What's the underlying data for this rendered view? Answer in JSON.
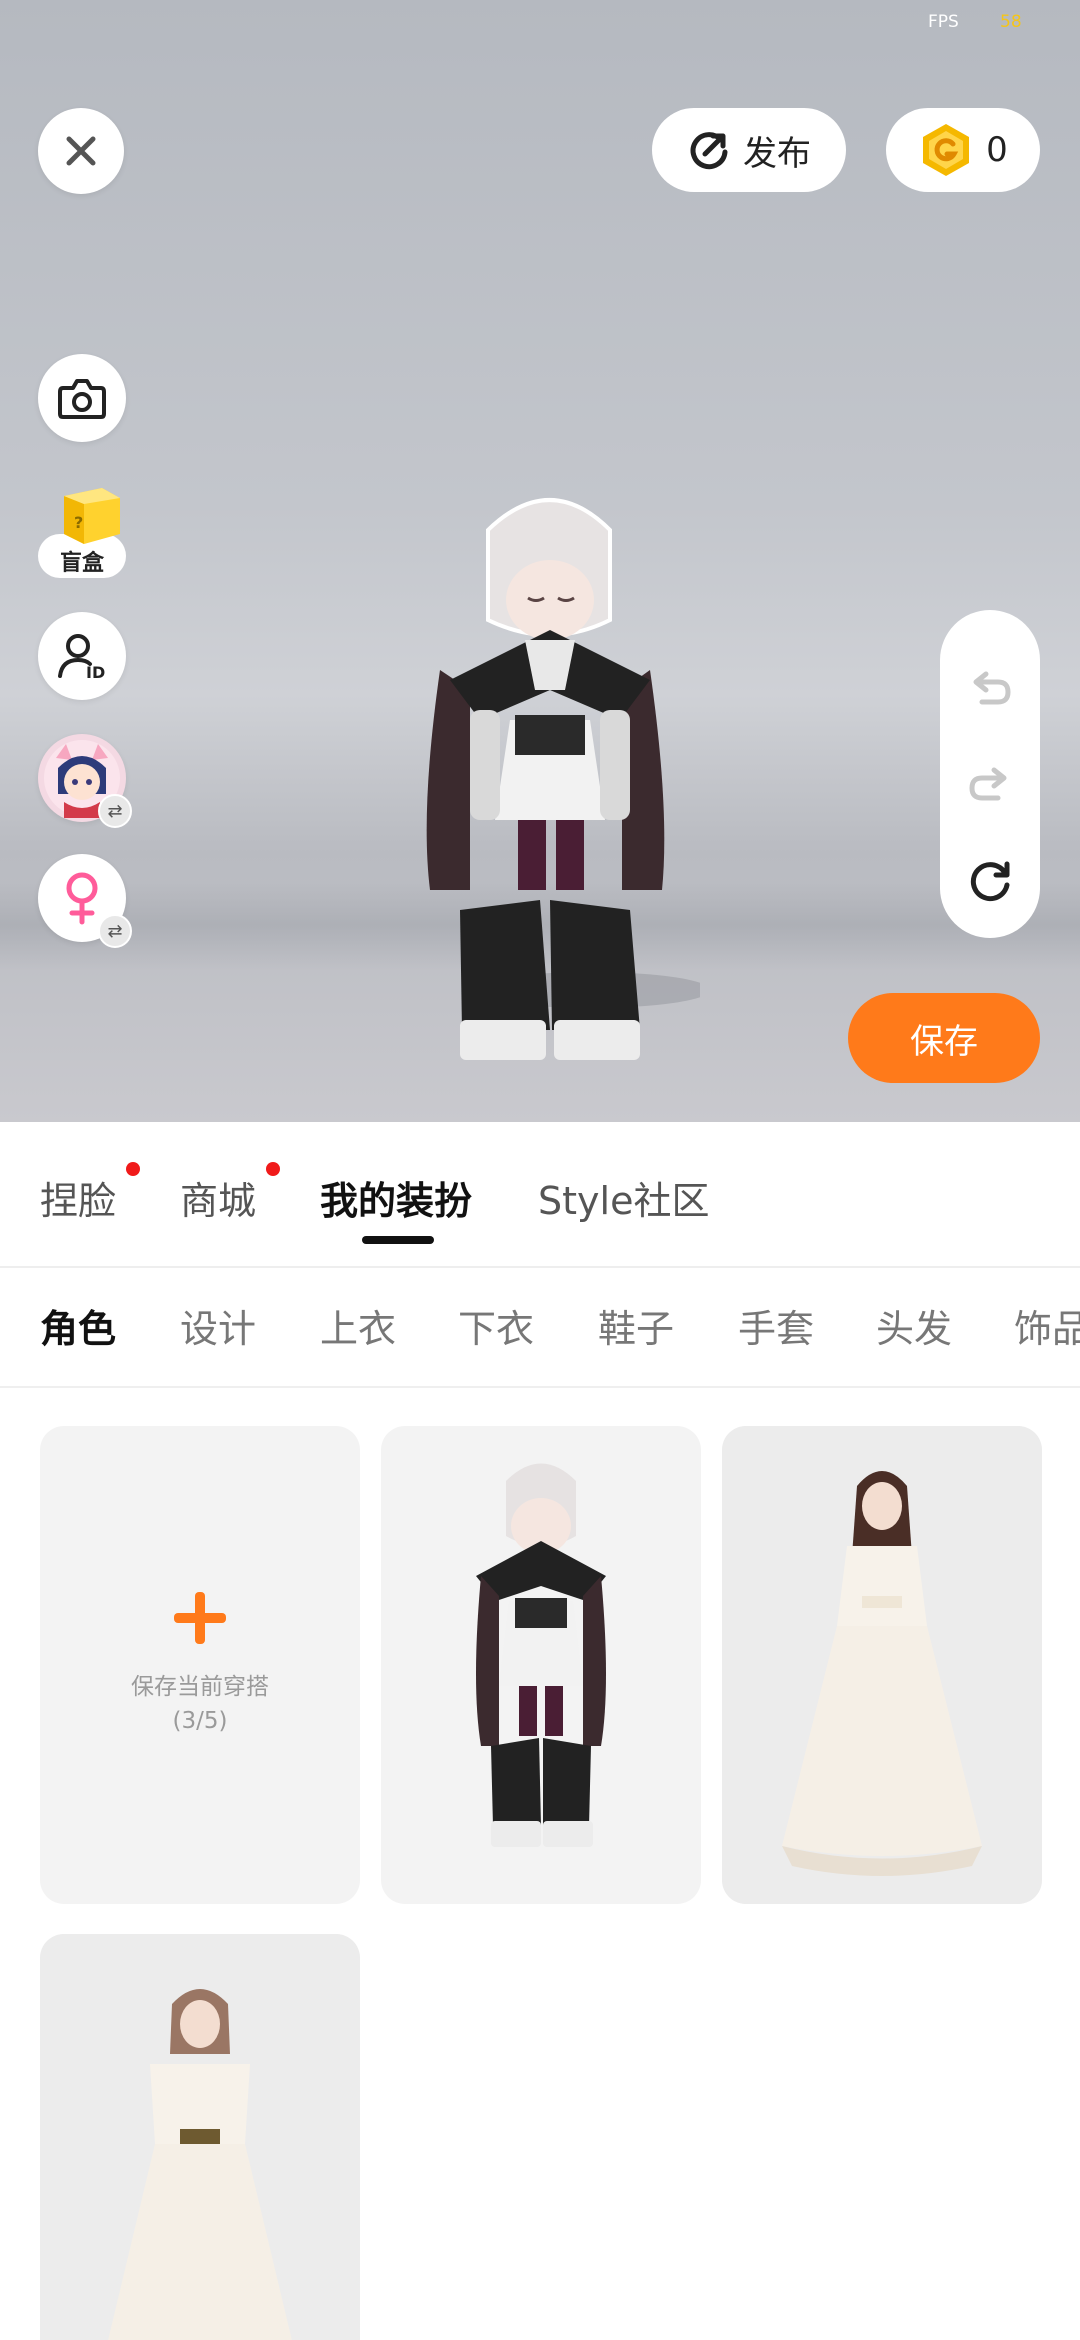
{
  "status": {
    "fps_label": "FPS",
    "fps_value": "58"
  },
  "header": {
    "publish_label": "发布",
    "coin_count": "0"
  },
  "side_tools": {
    "blindbox_label": "盲盒"
  },
  "actions": {
    "save_label": "保存"
  },
  "main_tabs": [
    {
      "label": "捏脸",
      "badge": true
    },
    {
      "label": "商城",
      "badge": true
    },
    {
      "label": "我的装扮",
      "active": true
    },
    {
      "label": "Style社区"
    }
  ],
  "sub_tabs": [
    {
      "label": "角色",
      "active": true
    },
    {
      "label": "设计"
    },
    {
      "label": "上衣"
    },
    {
      "label": "下衣"
    },
    {
      "label": "鞋子"
    },
    {
      "label": "手套"
    },
    {
      "label": "头发"
    },
    {
      "label": "饰品"
    }
  ],
  "outfits": {
    "add_label": "保存当前穿搭",
    "add_count": "(3/5)"
  },
  "colors": {
    "accent": "#ff7a1a",
    "badge_red": "#f01a1a",
    "coin": "#f5b800",
    "female_icon": "#ff5c9a"
  }
}
